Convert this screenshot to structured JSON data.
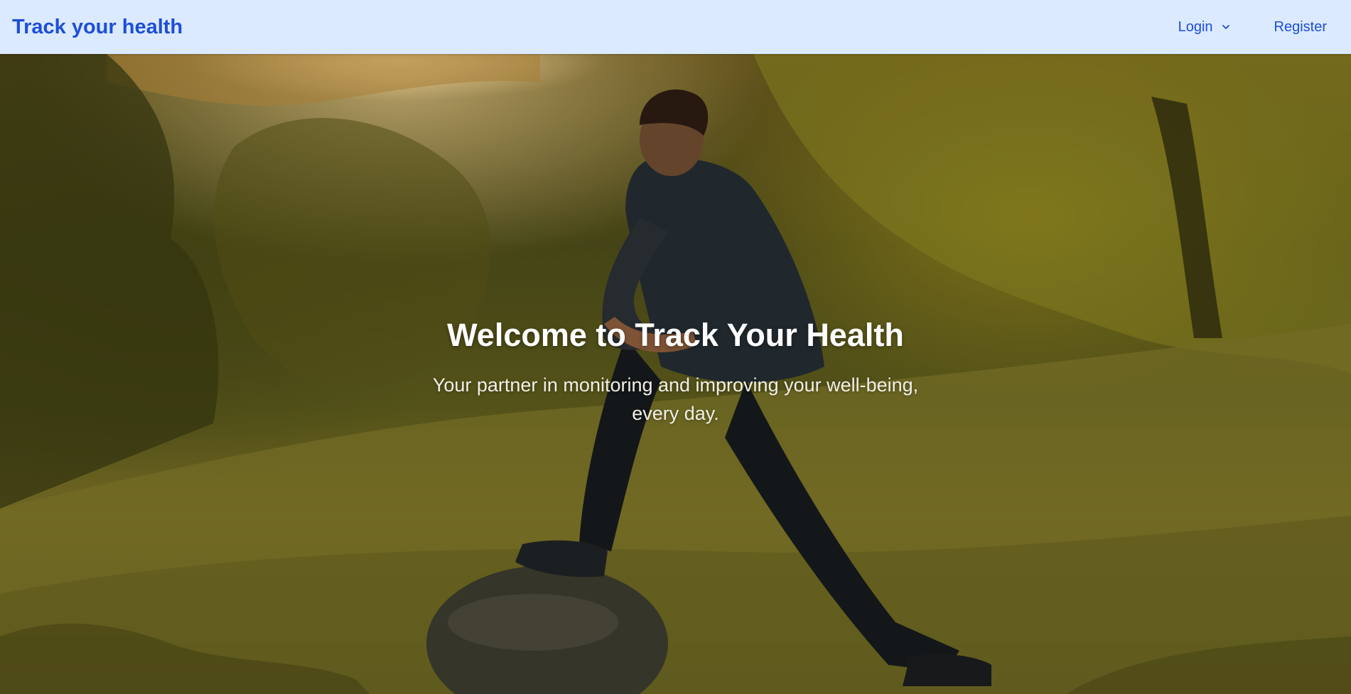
{
  "nav": {
    "brand": "Track your health",
    "login_label": "Login",
    "register_label": "Register"
  },
  "hero": {
    "title": "Welcome to Track Your Health",
    "subtitle": "Your partner in monitoring and improving your well-being, every day."
  },
  "colors": {
    "nav_background": "#dbeafe",
    "brand_blue": "#1d4ed8",
    "hero_text": "#ffffff"
  },
  "icons": {
    "login_dropdown": "chevron-down-icon"
  }
}
